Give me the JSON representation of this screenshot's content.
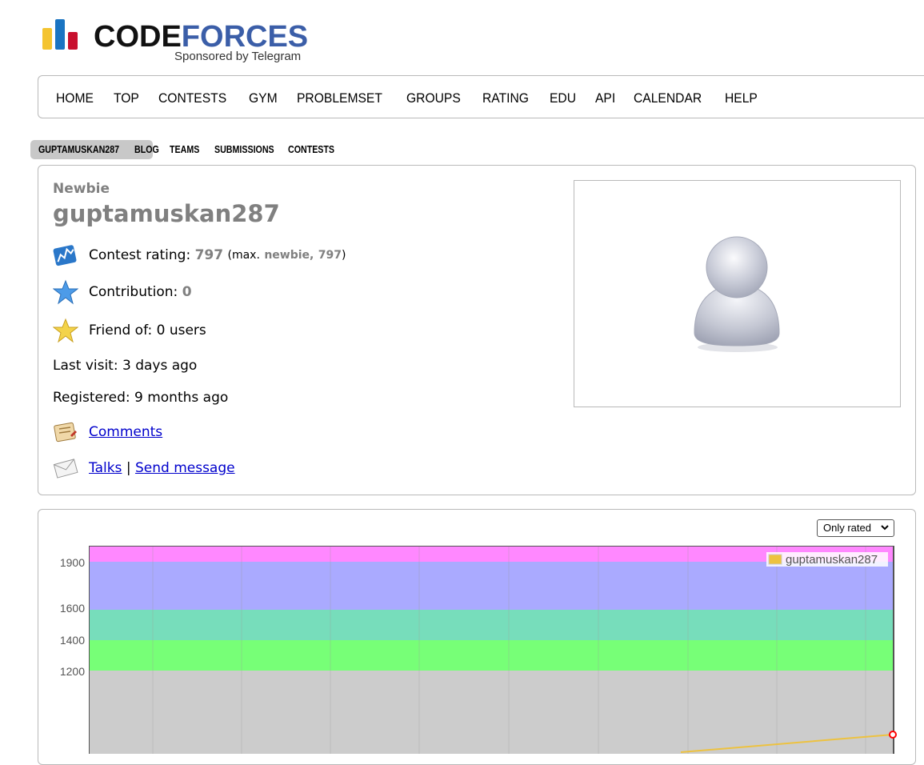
{
  "logo": {
    "word_code": "CODE",
    "word_forces": "FORCES",
    "sponsor": "Sponsored by Telegram"
  },
  "main_nav": [
    "HOME",
    "TOP",
    "CONTESTS",
    "GYM",
    "PROBLEMSET",
    "GROUPS",
    "RATING",
    "EDU",
    "API",
    "CALENDAR",
    "HELP"
  ],
  "second_nav": {
    "handle": "GUPTAMUSKAN287",
    "blog": "BLOG",
    "teams": "TEAMS",
    "submissions": "SUBMISSIONS",
    "contests": "CONTESTS"
  },
  "profile": {
    "rank": "Newbie",
    "handle": "guptamuskan287",
    "rating_label": "Contest rating:",
    "rating": "797",
    "max_open": "(max.",
    "max_rank": "newbie,",
    "max_rating": "797",
    "max_close": ")",
    "contribution_label": "Contribution:",
    "contribution": "0",
    "friend_of": "Friend of: 0 users",
    "last_visit": "Last visit: 3 days ago",
    "registered": "Registered: 9 months ago",
    "comments": "Comments",
    "talks": "Talks",
    "separator": "|",
    "send_message": "Send message"
  },
  "graph": {
    "filter": "Only rated",
    "legend": "guptamuskan287"
  },
  "chart_data": {
    "type": "line",
    "title": "",
    "series": [
      {
        "name": "guptamuskan287",
        "points": [
          [
            0,
            780
          ],
          [
            1,
            797
          ]
        ]
      }
    ],
    "y_ticks": [
      1200,
      1400,
      1600,
      1900
    ],
    "bands": [
      {
        "from": 1200,
        "to": 1400,
        "color": "#77ff77"
      },
      {
        "from": 1400,
        "to": 1600,
        "color": "#77ddbb"
      },
      {
        "from": 1600,
        "to": 1900,
        "color": "#aaaaff"
      },
      {
        "from": 1900,
        "to": 2100,
        "color": "#ff88ff"
      },
      {
        "from": 0,
        "to": 1200,
        "color": "#cccccc"
      }
    ],
    "grid": true,
    "legend_position": "top-right"
  },
  "colors": {
    "rank_gray": "#808080",
    "link": "#0000cc",
    "series": "#edc240",
    "point": "#ff0000"
  }
}
